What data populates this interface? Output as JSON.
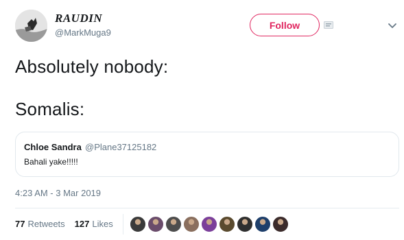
{
  "author": {
    "display_name": "RAUDIN",
    "handle": "@MarkMuga9"
  },
  "header": {
    "follow_label": "Follow"
  },
  "tweet": {
    "line1": "Absolutely nobody:",
    "line2": "Somalis:"
  },
  "quoted_tweet": {
    "name": "Chloe Sandra",
    "handle": "@Plane37125182",
    "text": "Bahali yake!!!!!"
  },
  "timestamp": "4:23 AM - 3 Mar 2019",
  "stats": {
    "retweets_count": "77",
    "retweets_label": "Retweets",
    "likes_count": "127",
    "likes_label": "Likes"
  },
  "colors": {
    "follow_accent": "#e0245e",
    "muted_text": "#657786",
    "divider": "#e6ecf0"
  },
  "icons": {
    "menu": "chevron-down-icon",
    "badge": "info-badge-icon"
  },
  "liker_avatars": [
    "#3a3a3a",
    "#6a4c6b",
    "#4d4d4d",
    "#8a6f5e",
    "#7b3f9a",
    "#5a4a2e",
    "#2f2f2f",
    "#1e3f6b",
    "#3b2b2b"
  ]
}
